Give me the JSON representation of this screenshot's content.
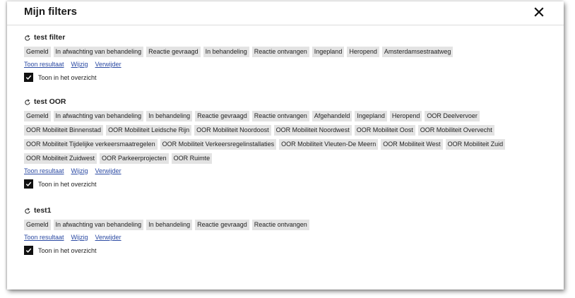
{
  "modal": {
    "title": "Mijn filters",
    "close_icon": "close-icon"
  },
  "filters": [
    {
      "name": "test filter",
      "tags": [
        "Gemeld",
        "In afwachting van behandeling",
        "Reactie gevraagd",
        "In behandeling",
        "Reactie ontvangen",
        "Ingepland",
        "Heropend",
        "Amsterdamsestraatweg"
      ],
      "actions": [
        "Toon resultaat",
        "Wijzig",
        "Verwijder"
      ],
      "overview_label": "Toon in het overzicht",
      "overview_checked": true
    },
    {
      "name": "test OOR",
      "tags": [
        "Gemeld",
        "In afwachting van behandeling",
        "In behandeling",
        "Reactie gevraagd",
        "Reactie ontvangen",
        "Afgehandeld",
        "Ingepland",
        "Heropend",
        "OOR Deelvervoer",
        "OOR Mobiliteit Binnenstad",
        "OOR Mobiliteit Leidsche Rijn",
        "OOR Mobiliteit Noordoost",
        "OOR Mobiliteit Noordwest",
        "OOR Mobiliteit Oost",
        "OOR Mobiliteit Overvecht",
        "OOR Mobiliteit Tijdelijke verkeersmaatregelen",
        "OOR Mobiliteit Verkeersregelinstallaties",
        "OOR Mobiliteit Vleuten-De Meern",
        "OOR Mobiliteit West",
        "OOR Mobiliteit Zuid",
        "OOR Mobiliteit Zuidwest",
        "OOR Parkeerprojecten",
        "OOR Ruimte"
      ],
      "actions": [
        "Toon resultaat",
        "Wijzig",
        "Verwijder"
      ],
      "overview_label": "Toon in het overzicht",
      "overview_checked": true
    },
    {
      "name": "test1",
      "tags": [
        "Gemeld",
        "In afwachting van behandeling",
        "In behandeling",
        "Reactie gevraagd",
        "Reactie ontvangen"
      ],
      "actions": [
        "Toon resultaat",
        "Wijzig",
        "Verwijder"
      ],
      "overview_label": "Toon in het overzicht",
      "overview_checked": true
    }
  ],
  "colors": {
    "tag_bg": "#e3e3e3",
    "link": "#2b4aa3",
    "checkbox": "#111111"
  }
}
